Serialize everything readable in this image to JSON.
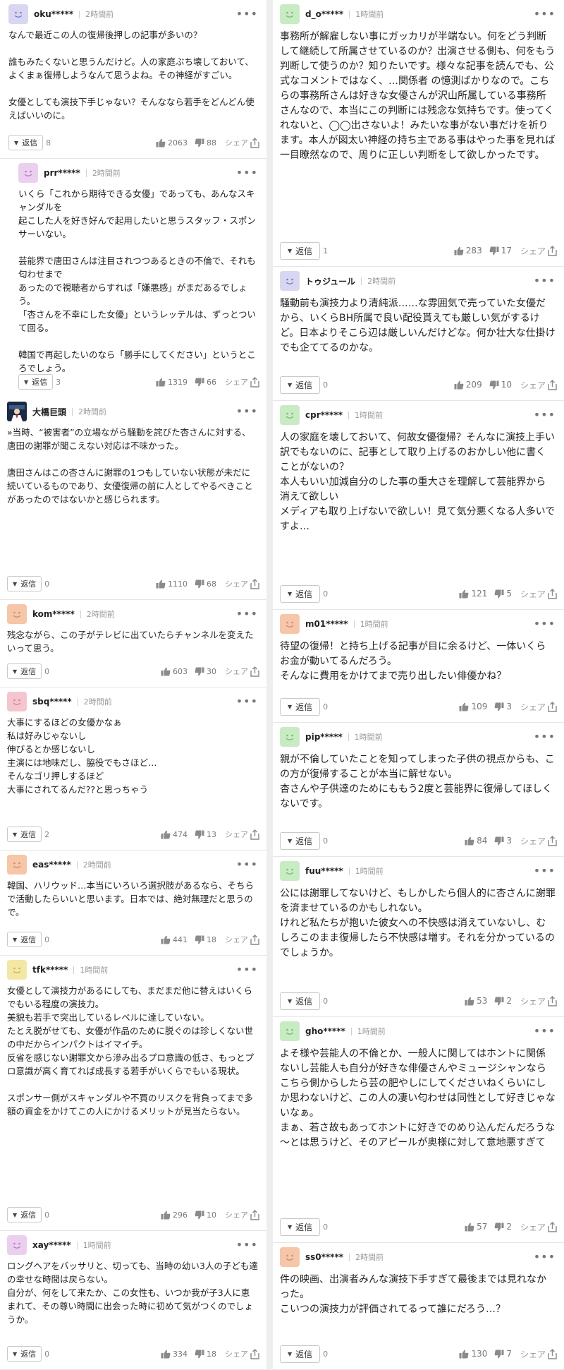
{
  "ui": {
    "reply_label": "返信",
    "share_label": "シェア"
  },
  "left": [
    {
      "user": "oku*****",
      "time": "2時間前",
      "avatar_color": "#d9d6f2",
      "face": "#6e7fd0",
      "text": "なんで最近この人の復帰後押しの記事が多いの？\n\n誰もみたくないと思うんだけど。人の家庭ぶち壊しておいて、よくまぁ復帰しようなんて思うよね。その神経がすごい。\n\n女優としても演技下手じゃない？そんななら若手をどんどん使えばいいのに。",
      "replies": "8",
      "likes": "2063",
      "dislikes": "88"
    },
    {
      "user": "prr*****",
      "time": "2時間前",
      "avatar_color": "#ead0ee",
      "face": "#b77cc6",
      "text": "いくら「これから期待できる女優」であっても、あんなスキャンダルを\n起こした人を好き好んで起用したいと思うスタッフ・スポンサーいない。\n\n芸能界で唐田さんは注目されつつあるときの不倫で、それも匂わせまで\nあったので視聴者からすれば「嫌悪感」がまだあるでしょう。\n「杏さんを不幸にした女優」というレッテルは、ずっとついて回る。\n\n韓国で再起したいのなら「勝手にしてください」というところでしょう。",
      "replies": "3",
      "likes": "1319",
      "dislikes": "66"
    },
    {
      "user": "大橋巨頭",
      "time": "2時間前",
      "avatar_color": "#1e2a44",
      "face": "#ffffff",
      "text": "»当時、“被害者”の立場ながら騒動を詫びた杏さんに対する、唐田の謝罪が聞こえない対応は不味かった。\n\n唐田さんはこの杏さんに謝罪の1つもしていない状態が未だに続いているものであり、女優復帰の前に人としてやるべきことがあったのではないかと感じられます。",
      "replies": "0",
      "likes": "1110",
      "dislikes": "68"
    },
    {
      "user": "kom*****",
      "time": "2時間前",
      "avatar_color": "#f5c6a8",
      "face": "#d9876a",
      "text": "残念ながら、この子がテレビに出ていたらチャンネルを変えたいって思う。",
      "replies": "0",
      "likes": "603",
      "dislikes": "30"
    },
    {
      "user": "sbq*****",
      "time": "2時間前",
      "avatar_color": "#f5c5cf",
      "face": "#d97d90",
      "text": "大事にするほどの女優かなぁ\n私は好みじゃないし\n伸びるとか感じないし\n主演には地味だし、脇役でもさほど…\nそんなゴリ押しするほど\n大事にされてるんだ??と思っちゃう",
      "replies": "2",
      "likes": "474",
      "dislikes": "13"
    },
    {
      "user": "eas*****",
      "time": "2時間前",
      "avatar_color": "#f5c6a8",
      "face": "#d9876a",
      "text": "韓国、ハリウッド…本当にいろいろ選択肢があるなら、そちらで活動したらいいと思います。日本では、絶対無理だと思うので。",
      "replies": "0",
      "likes": "441",
      "dislikes": "18"
    },
    {
      "user": "tfk*****",
      "time": "1時間前",
      "avatar_color": "#f3e7a6",
      "face": "#c9b34a",
      "text": "女優として演技力があるにしても、まだまだ他に替えはいくらでもいる程度の演技力。\n美貌も若手で突出しているレベルに達していない。\nたとえ脱がせても、女優が作品のために脱ぐのは珍しくない世の中だからインパクトはイマイチ。\n反省を感じない謝罪文から滲み出るプロ意識の低さ、もっとプロ意識が高く育てれば成長する若手がいくらでもいる現状。\n\nスポンサー側がスキャンダルや不買のリスクを背負ってまで多額の資金をかけてこの人にかけるメリットが見当たらない。",
      "replies": "0",
      "likes": "296",
      "dislikes": "10"
    },
    {
      "user": "xay*****",
      "time": "1時間前",
      "avatar_color": "#ead0ee",
      "face": "#b77cc6",
      "text": "ロングヘアをバッサリと、切っても、当時の幼い3人の子ども達の幸せな時間は戻らない。\n自分が、何をして来たか、この女性も、いつか我が子3人に恵まれて、その尊い時間に出会った時に初めて気がつくのでしょうか。",
      "replies": "0",
      "likes": "334",
      "dislikes": "18"
    }
  ],
  "right": [
    {
      "user": "d_o*****",
      "time": "1時間前",
      "avatar_color": "#c9ebc4",
      "face": "#6fbf6a",
      "text": "事務所が解雇しない事にガッカリが半端ない。何をどう判断して継続して所属させているのか？出演させる側も、何をもう判断して使うのか？知りたいです。様々な記事を読んでも、公式なコメントではなく、…関係者 の憶測ばかりなので。こちらの事務所さんは好きな女優さんが沢山所属している事務所さんなので、本当にこの判断には残念な気持ちです。使ってくれないと、◯◯出さないよ！みたいな事がない事だけを祈ります。本人が図太い神経の持ち主である事はやった事を見れば一目瞭然なので、周りに正しい判断をして欲しかったです。",
      "replies": "1",
      "likes": "283",
      "dislikes": "17"
    },
    {
      "user": "トゥジュール",
      "time": "2時間前",
      "avatar_color": "#d9d6f2",
      "face": "#6e7fd0",
      "text": "騒動前も演技力より清純派……な雰囲気で売っていた女優だから、いくらBH所属で良い配役貰えても厳しい気がするけど。日本よりそこら辺は厳しいんだけどな。何か壮大な仕掛けでも企ててるのかな。",
      "replies": "0",
      "likes": "209",
      "dislikes": "10"
    },
    {
      "user": "cpr*****",
      "time": "1時間前",
      "avatar_color": "#c9ebc4",
      "face": "#6fbf6a",
      "text": "人の家庭を壊しておいて、何故女優復帰？そんなに演技上手い訳でもないのに、記事として取り上げるのおかしい他に書くことがないの？\n本人もいい加減自分のした事の重大さを理解して芸能界から消えて欲しい\nメディアも取り上げないで欲しい！見て気分悪くなる人多いですよ…",
      "replies": "0",
      "likes": "121",
      "dislikes": "5"
    },
    {
      "user": "m01*****",
      "time": "1時間前",
      "avatar_color": "#f5c6a8",
      "face": "#d9876a",
      "text": "待望の復帰！と持ち上げる記事が目に余るけど、一体いくらお金が動いてるんだろう。\nそんなに費用をかけてまで売り出したい俳優かね？",
      "replies": "0",
      "likes": "109",
      "dislikes": "3"
    },
    {
      "user": "pip*****",
      "time": "1時間前",
      "avatar_color": "#c9ebc4",
      "face": "#6fbf6a",
      "text": "親が不倫していたことを知ってしまった子供の視点からも、この方が復帰することが本当に解せない。\n杏さんや子供達のためにももう2度と芸能界に復帰してほしくないです。",
      "replies": "0",
      "likes": "84",
      "dislikes": "3"
    },
    {
      "user": "fuu*****",
      "time": "1時間前",
      "avatar_color": "#c9ebc4",
      "face": "#6fbf6a",
      "text": "公には謝罪してないけど、もしかしたら個人的に杏さんに謝罪を済ませているのかもしれない。\nけれど私たちが抱いた彼女への不快感は消えていないし、むしろこのまま復帰したら不快感は増す。それを分かっているのでしょうか。",
      "replies": "0",
      "likes": "53",
      "dislikes": "2"
    },
    {
      "user": "gho*****",
      "time": "1時間前",
      "avatar_color": "#c9ebc4",
      "face": "#6fbf6a",
      "text": "よそ様や芸能人の不倫とか、一般人に関してはホントに関係ないし芸能人も自分が好きな俳優さんやミュージシャンならこちら側からしたら芸の肥やしにしてくださいねくらいにしか思わないけど、この人の凄い匂わせは同性として好きじゃないなぁ。\nまぁ、若さ故もあってホントに好きでのめり込んだんだろうな～とは思うけど、そのアピールが奥様に対して意地悪すぎて",
      "replies": "0",
      "likes": "57",
      "dislikes": "2"
    },
    {
      "user": "ss0*****",
      "time": "2時間前",
      "avatar_color": "#f5c6a8",
      "face": "#d9876a",
      "text": "件の映画、出演者みんな演技下手すぎて最後までは見れなかった。\nこいつの演技力が評価されてるって誰にだろう…？",
      "replies": "0",
      "likes": "130",
      "dislikes": "7"
    }
  ]
}
